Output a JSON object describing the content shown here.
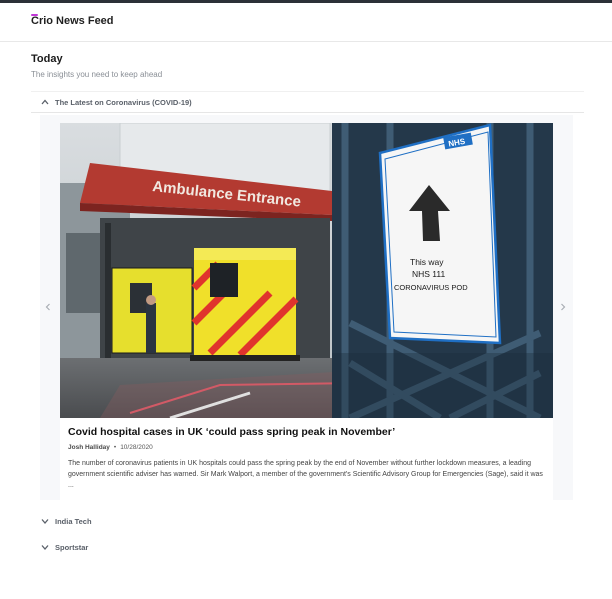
{
  "app": {
    "brand": "Crio News Feed",
    "accent": "#c238d8"
  },
  "page": {
    "heading": "Today",
    "subheading": "The insights you need to keep ahead"
  },
  "sections": [
    {
      "label": "The Latest on Coronavirus (COVID-19)",
      "expanded": true
    },
    {
      "label": "India Tech",
      "expanded": false
    },
    {
      "label": "Sportstar",
      "expanded": false
    }
  ],
  "carousel": {
    "prev_icon": "chevron-left-icon",
    "next_icon": "chevron-right-icon",
    "article": {
      "title": "Covid hospital cases in UK ‘could pass spring peak in November’",
      "author": "Josh Halliday",
      "separator": "•",
      "date": "10/28/2020",
      "description": "The number of coronavirus patients in UK hospitals could pass the spring peak by the end of November without further lockdown measures, a leading government scientific adviser has warned. Sir Mark Walport, a member of the government's Scientific Advisory Group for Emergencies (Sage), said it was ..."
    },
    "image_text": {
      "building_sign": "Ambulance Entrance",
      "poster_logo": "NHS",
      "poster_line1": "This way",
      "poster_line2": "NHS 111",
      "poster_line3": "CORONAVIRUS POD"
    }
  }
}
